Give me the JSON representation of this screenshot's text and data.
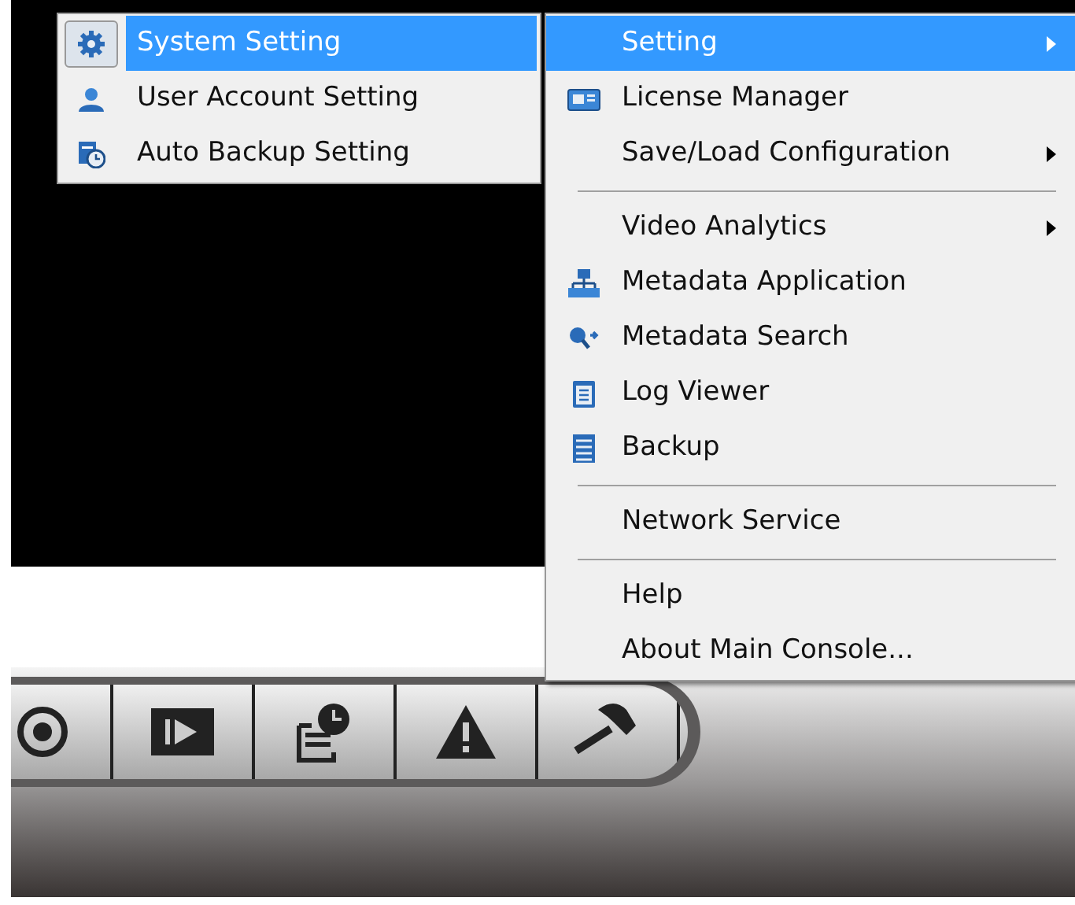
{
  "submenu": [
    {
      "label": "System Setting",
      "selected": true
    },
    {
      "label": "User Account Setting",
      "selected": false
    },
    {
      "label": "Auto Backup Setting",
      "selected": false
    }
  ],
  "menu": [
    {
      "kind": "item",
      "label": "Setting",
      "has_submenu": true,
      "selected": true
    },
    {
      "kind": "item",
      "label": "License Manager",
      "has_submenu": false,
      "selected": false
    },
    {
      "kind": "item",
      "label": "Save/Load Configuration",
      "has_submenu": true,
      "selected": false
    },
    {
      "kind": "separator"
    },
    {
      "kind": "item",
      "label": "Video Analytics",
      "has_submenu": true,
      "selected": false
    },
    {
      "kind": "item",
      "label": "Metadata Application",
      "has_submenu": false,
      "selected": false
    },
    {
      "kind": "item",
      "label": "Metadata Search",
      "has_submenu": false,
      "selected": false
    },
    {
      "kind": "item",
      "label": "Log Viewer",
      "has_submenu": false,
      "selected": false
    },
    {
      "kind": "item",
      "label": "Backup",
      "has_submenu": false,
      "selected": false
    },
    {
      "kind": "separator"
    },
    {
      "kind": "item",
      "label": "Network Service",
      "has_submenu": false,
      "selected": false
    },
    {
      "kind": "separator"
    },
    {
      "kind": "item",
      "label": "Help",
      "has_submenu": false,
      "selected": false
    },
    {
      "kind": "item",
      "label": "About Main Console...",
      "has_submenu": false,
      "selected": false
    }
  ]
}
